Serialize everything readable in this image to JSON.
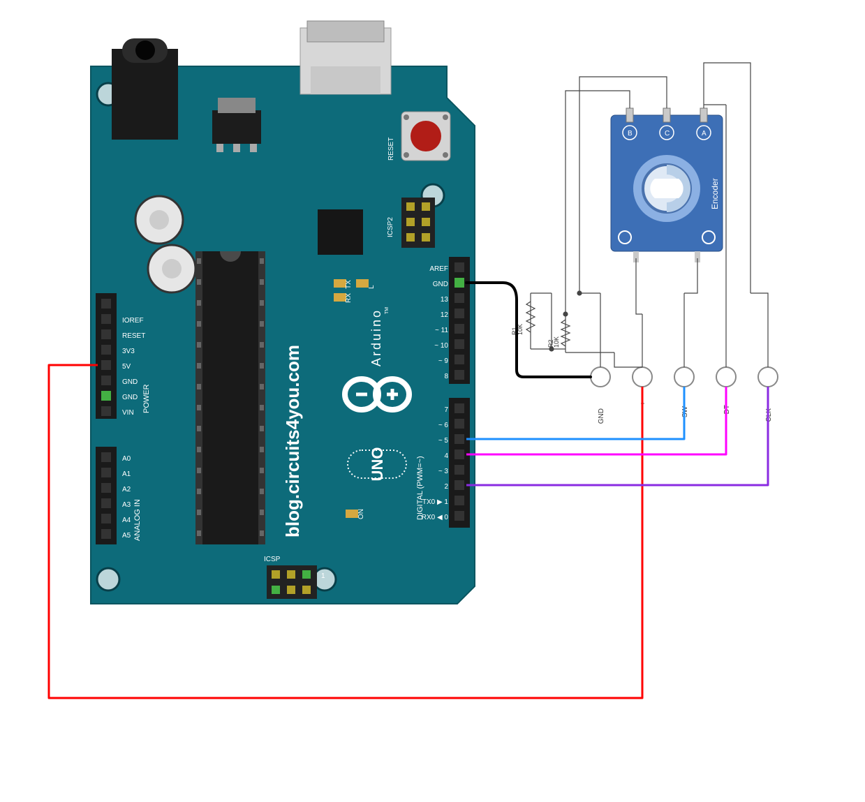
{
  "watermark": "blog.circuits4you.com",
  "board": {
    "name": "Arduino",
    "model": "UNO",
    "tm": "TM",
    "reset": "RESET",
    "icsp": "ICSP",
    "icsp2": "ICSP2",
    "icsp_one": "1",
    "tx": "TX",
    "rx": "RX",
    "L": "L",
    "on": "ON",
    "power_section": "POWER",
    "analog_section": "ANALOG IN",
    "digital_section": "DIGITAL (PWM=~)",
    "pins_power": [
      "IOREF",
      "RESET",
      "3V3",
      "5V",
      "GND",
      "GND",
      "VIN"
    ],
    "pins_analog": [
      "A0",
      "A1",
      "A2",
      "A3",
      "A4",
      "A5"
    ],
    "pins_digital_upper": [
      "AREF",
      "GND",
      "13",
      "12",
      "~ 11",
      "~ 10",
      "~ 9",
      "8"
    ],
    "pins_digital_lower": [
      "7",
      "~ 6",
      "~ 5",
      "4",
      "~ 3",
      "2",
      "TX0 ▶ 1",
      "RX0 ◀ 0"
    ]
  },
  "encoder": {
    "title": "Encoder",
    "top_pins": [
      "B",
      "C",
      "A"
    ],
    "bottom_pins": [
      "GND",
      "+",
      "SW",
      "DT",
      "CLK"
    ]
  },
  "resistors": {
    "r1": {
      "value": "10K",
      "ref": "R1"
    },
    "r2": {
      "value": "10K",
      "ref": "R2"
    }
  },
  "wires": {
    "gnd_color": "#000000",
    "vcc_color": "#ff0000",
    "sw_color": "#1e90ff",
    "dt_color": "#ff00ff",
    "clk_color": "#8a2be2",
    "sig_color": "#444444"
  },
  "connections": [
    {
      "from": "Arduino 5V",
      "to": "Encoder +",
      "color": "red"
    },
    {
      "from": "Arduino GND (digital)",
      "to": "Encoder GND",
      "color": "black"
    },
    {
      "from": "Arduino D5",
      "to": "Encoder SW",
      "color": "blue"
    },
    {
      "from": "Arduino D4",
      "to": "Encoder DT",
      "color": "magenta"
    },
    {
      "from": "Arduino D2",
      "to": "Encoder CLK",
      "color": "purple"
    }
  ]
}
